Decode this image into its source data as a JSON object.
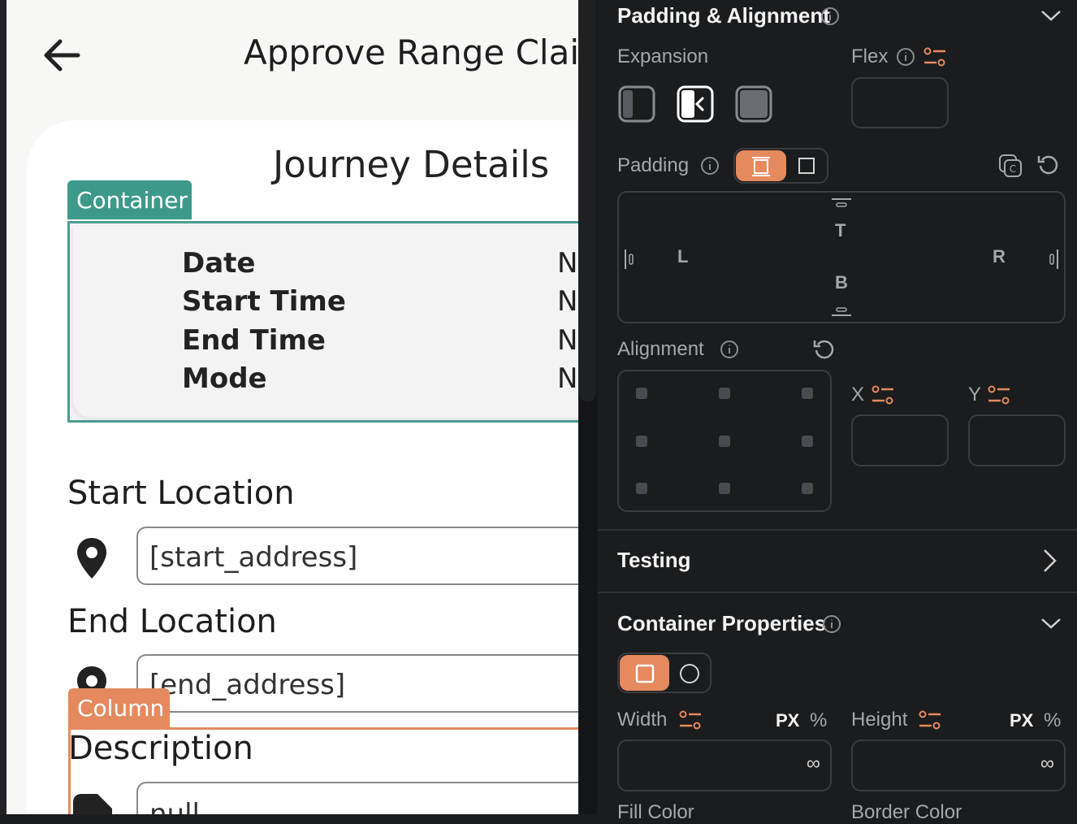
{
  "canvas": {
    "page_title": "Approve Range Claim",
    "card_title": "Journey Details",
    "container_tag": "Container",
    "column_tag": "Column",
    "details": [
      {
        "label": "Date",
        "value": "N"
      },
      {
        "label": "Start Time",
        "value": "N"
      },
      {
        "label": "End Time",
        "value": "N"
      },
      {
        "label": "Mode",
        "value": "N"
      }
    ],
    "start_location_label": "Start Location",
    "start_address": "[start_address]",
    "end_location_label": "End Location",
    "end_address": "[end_address]",
    "description_label": "Description",
    "description_value": "null"
  },
  "panel": {
    "padding_alignment_title": "Padding & Alignment",
    "expansion_label": "Expansion",
    "flex_label": "Flex",
    "padding_label": "Padding",
    "padding_sides": {
      "top": "T",
      "left": "L",
      "right": "R",
      "bottom": "B"
    },
    "alignment_label": "Alignment",
    "x_label": "X",
    "y_label": "Y",
    "testing_title": "Testing",
    "container_properties_title": "Container Properties",
    "width_label": "Width",
    "height_label": "Height",
    "unit_px": "PX",
    "unit_percent": "%",
    "width_value": "∞",
    "height_value": "∞",
    "fill_color_label": "Fill Color",
    "border_color_label": "Border Color"
  },
  "colors": {
    "accent": "#e48a5e",
    "container_tag": "#3d9a8a",
    "panel_bg": "#1b1c1e"
  }
}
